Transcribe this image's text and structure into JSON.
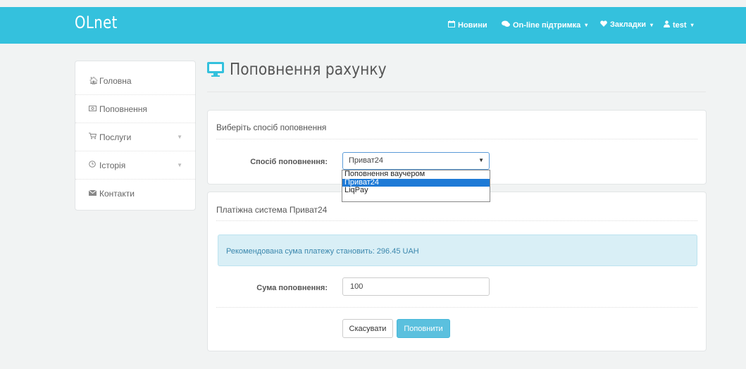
{
  "navbar": {
    "brand": "OLnet",
    "items": [
      {
        "icon": "calendar-icon",
        "label": "Новини",
        "dropdown": false
      },
      {
        "icon": "comments-icon",
        "label": "On-line підтримка",
        "dropdown": true
      },
      {
        "icon": "heart-icon",
        "label": "Закладки",
        "dropdown": true
      },
      {
        "icon": "user-icon",
        "label": "test",
        "dropdown": true
      }
    ],
    "color": "#34c1dd"
  },
  "sidebar": {
    "items": [
      {
        "icon": "home-icon",
        "label": "Головна",
        "expandable": false
      },
      {
        "icon": "money-icon",
        "label": "Поповнення",
        "expandable": false
      },
      {
        "icon": "cart-icon",
        "label": "Послуги",
        "expandable": true
      },
      {
        "icon": "clock-icon",
        "label": "Історія",
        "expandable": true
      },
      {
        "icon": "envelope-icon",
        "label": "Контакти",
        "expandable": false
      }
    ]
  },
  "page": {
    "icon": "monitor-icon",
    "title": "Поповнення рахунку"
  },
  "method_panel": {
    "title": "Виберіть спосіб поповнення",
    "field_label": "Спосіб поповнення:",
    "selected": "Приват24",
    "options": [
      "Поповнення ваучером",
      "Приват24",
      "LiqPay"
    ]
  },
  "payment_panel": {
    "title": "Платіжна система Приват24",
    "alert": "Рекомендована сума платежу становить: 296.45 UAH",
    "amount_label": "Сума поповнення:",
    "amount_value": "100",
    "cancel_label": "Скасувати",
    "submit_label": "Поповнити"
  }
}
